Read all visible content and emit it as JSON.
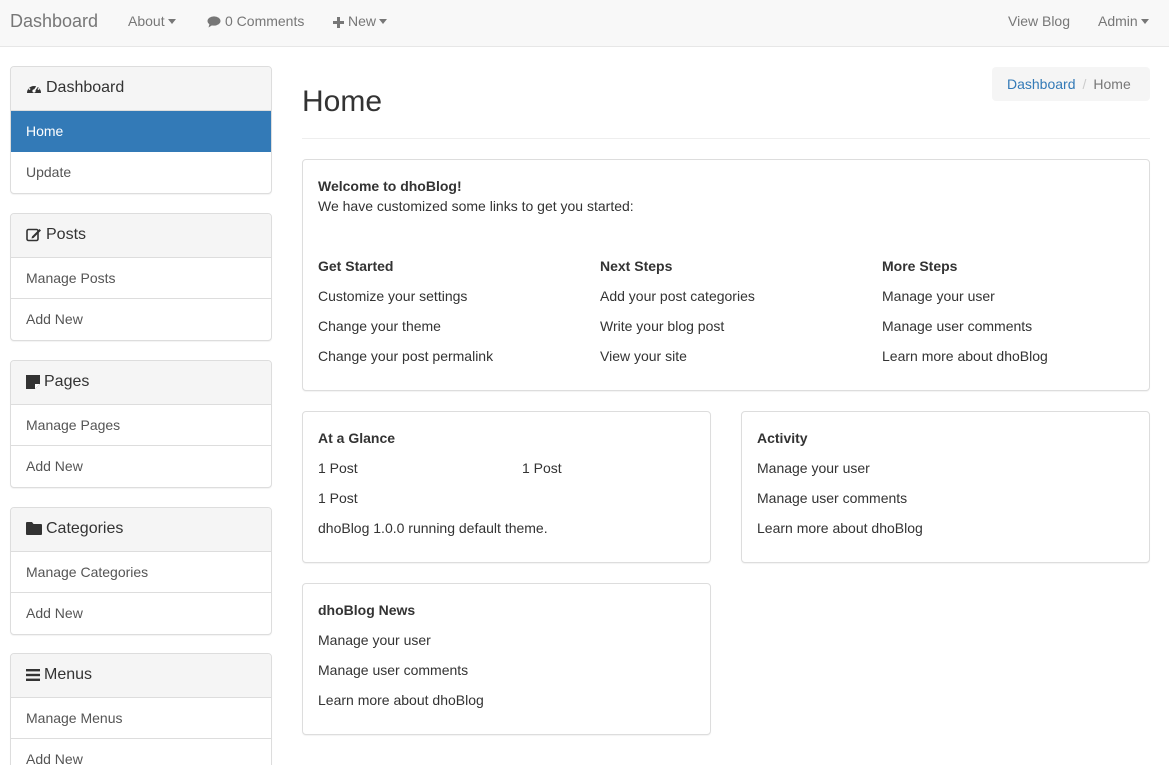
{
  "navbar": {
    "brand": "Dashboard",
    "about": "About",
    "comments": "0 Comments",
    "new": "New",
    "view_blog": "View Blog",
    "admin": "Admin"
  },
  "sidebar": {
    "dashboard": {
      "heading": "Dashboard",
      "items": [
        "Home",
        "Update"
      ]
    },
    "posts": {
      "heading": "Posts",
      "items": [
        "Manage Posts",
        "Add New"
      ]
    },
    "pages": {
      "heading": "Pages",
      "items": [
        "Manage Pages",
        "Add New"
      ]
    },
    "categories": {
      "heading": "Categories",
      "items": [
        "Manage Categories",
        "Add New"
      ]
    },
    "menus": {
      "heading": "Menus",
      "items": [
        "Manage Menus",
        "Add New"
      ]
    }
  },
  "main": {
    "title": "Home",
    "breadcrumb": {
      "link": "Dashboard",
      "sep": "/",
      "current": "Home"
    },
    "welcome": {
      "title": "Welcome to dhoBlog!",
      "subtitle": "We have customized some links to get you started:",
      "columns": [
        {
          "heading": "Get Started",
          "links": [
            "Customize your settings",
            "Change your theme",
            "Change your post permalink"
          ]
        },
        {
          "heading": "Next Steps",
          "links": [
            "Add your post categories",
            "Write your blog post",
            "View your site"
          ]
        },
        {
          "heading": "More Steps",
          "links": [
            "Manage your user",
            "Manage user comments",
            "Learn more about dhoBlog"
          ]
        }
      ]
    },
    "glance": {
      "title": "At a Glance",
      "items": [
        "1 Post",
        "1 Post",
        "1 Post"
      ],
      "footer": "dhoBlog 1.0.0 running default theme."
    },
    "activity": {
      "title": "Activity",
      "items": [
        "Manage your user",
        "Manage user comments",
        "Learn more about dhoBlog"
      ]
    },
    "news": {
      "title": "dhoBlog News",
      "items": [
        "Manage your user",
        "Manage user comments",
        "Learn more about dhoBlog"
      ]
    }
  },
  "colors": {
    "accent": "#337ab7",
    "navbar_bg": "#f8f8f8",
    "panel_heading_bg": "#f5f5f5",
    "border": "#dddddd"
  },
  "icons": {
    "dashboard": "tachometer-icon",
    "posts": "edit-icon",
    "pages": "sticky-note-icon",
    "categories": "folder-icon",
    "menus": "bars-icon",
    "comments": "comment-icon",
    "new": "plus-icon"
  }
}
